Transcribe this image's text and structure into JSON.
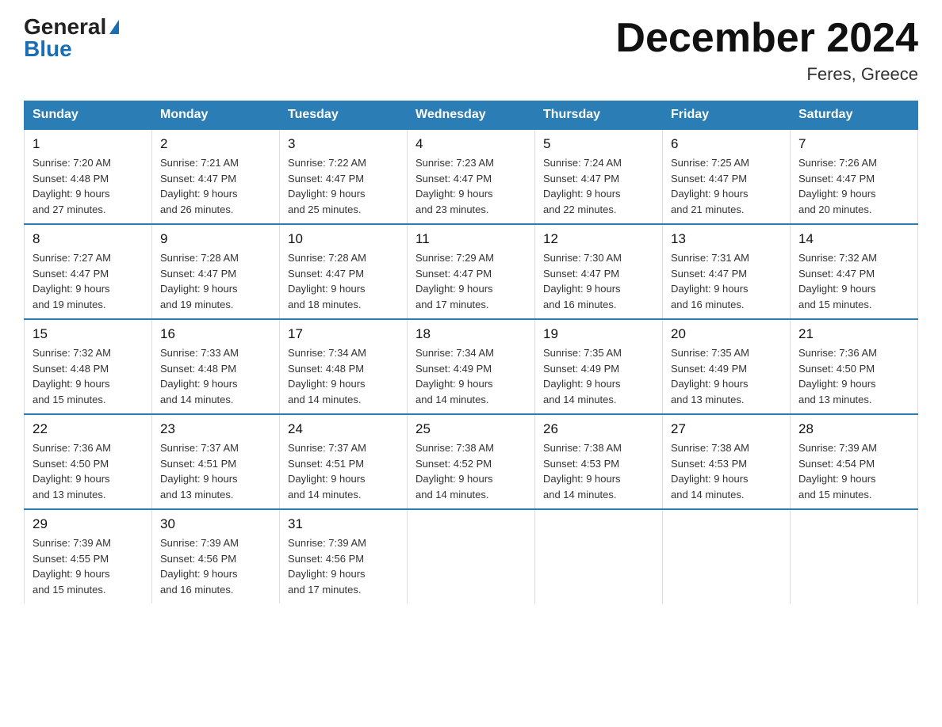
{
  "logo": {
    "general": "General",
    "blue": "Blue"
  },
  "title": "December 2024",
  "location": "Feres, Greece",
  "days_of_week": [
    "Sunday",
    "Monday",
    "Tuesday",
    "Wednesday",
    "Thursday",
    "Friday",
    "Saturday"
  ],
  "weeks": [
    [
      {
        "day": "1",
        "sunrise": "7:20 AM",
        "sunset": "4:48 PM",
        "daylight": "9 hours and 27 minutes."
      },
      {
        "day": "2",
        "sunrise": "7:21 AM",
        "sunset": "4:47 PM",
        "daylight": "9 hours and 26 minutes."
      },
      {
        "day": "3",
        "sunrise": "7:22 AM",
        "sunset": "4:47 PM",
        "daylight": "9 hours and 25 minutes."
      },
      {
        "day": "4",
        "sunrise": "7:23 AM",
        "sunset": "4:47 PM",
        "daylight": "9 hours and 23 minutes."
      },
      {
        "day": "5",
        "sunrise": "7:24 AM",
        "sunset": "4:47 PM",
        "daylight": "9 hours and 22 minutes."
      },
      {
        "day": "6",
        "sunrise": "7:25 AM",
        "sunset": "4:47 PM",
        "daylight": "9 hours and 21 minutes."
      },
      {
        "day": "7",
        "sunrise": "7:26 AM",
        "sunset": "4:47 PM",
        "daylight": "9 hours and 20 minutes."
      }
    ],
    [
      {
        "day": "8",
        "sunrise": "7:27 AM",
        "sunset": "4:47 PM",
        "daylight": "9 hours and 19 minutes."
      },
      {
        "day": "9",
        "sunrise": "7:28 AM",
        "sunset": "4:47 PM",
        "daylight": "9 hours and 19 minutes."
      },
      {
        "day": "10",
        "sunrise": "7:28 AM",
        "sunset": "4:47 PM",
        "daylight": "9 hours and 18 minutes."
      },
      {
        "day": "11",
        "sunrise": "7:29 AM",
        "sunset": "4:47 PM",
        "daylight": "9 hours and 17 minutes."
      },
      {
        "day": "12",
        "sunrise": "7:30 AM",
        "sunset": "4:47 PM",
        "daylight": "9 hours and 16 minutes."
      },
      {
        "day": "13",
        "sunrise": "7:31 AM",
        "sunset": "4:47 PM",
        "daylight": "9 hours and 16 minutes."
      },
      {
        "day": "14",
        "sunrise": "7:32 AM",
        "sunset": "4:47 PM",
        "daylight": "9 hours and 15 minutes."
      }
    ],
    [
      {
        "day": "15",
        "sunrise": "7:32 AM",
        "sunset": "4:48 PM",
        "daylight": "9 hours and 15 minutes."
      },
      {
        "day": "16",
        "sunrise": "7:33 AM",
        "sunset": "4:48 PM",
        "daylight": "9 hours and 14 minutes."
      },
      {
        "day": "17",
        "sunrise": "7:34 AM",
        "sunset": "4:48 PM",
        "daylight": "9 hours and 14 minutes."
      },
      {
        "day": "18",
        "sunrise": "7:34 AM",
        "sunset": "4:49 PM",
        "daylight": "9 hours and 14 minutes."
      },
      {
        "day": "19",
        "sunrise": "7:35 AM",
        "sunset": "4:49 PM",
        "daylight": "9 hours and 14 minutes."
      },
      {
        "day": "20",
        "sunrise": "7:35 AM",
        "sunset": "4:49 PM",
        "daylight": "9 hours and 13 minutes."
      },
      {
        "day": "21",
        "sunrise": "7:36 AM",
        "sunset": "4:50 PM",
        "daylight": "9 hours and 13 minutes."
      }
    ],
    [
      {
        "day": "22",
        "sunrise": "7:36 AM",
        "sunset": "4:50 PM",
        "daylight": "9 hours and 13 minutes."
      },
      {
        "day": "23",
        "sunrise": "7:37 AM",
        "sunset": "4:51 PM",
        "daylight": "9 hours and 13 minutes."
      },
      {
        "day": "24",
        "sunrise": "7:37 AM",
        "sunset": "4:51 PM",
        "daylight": "9 hours and 14 minutes."
      },
      {
        "day": "25",
        "sunrise": "7:38 AM",
        "sunset": "4:52 PM",
        "daylight": "9 hours and 14 minutes."
      },
      {
        "day": "26",
        "sunrise": "7:38 AM",
        "sunset": "4:53 PM",
        "daylight": "9 hours and 14 minutes."
      },
      {
        "day": "27",
        "sunrise": "7:38 AM",
        "sunset": "4:53 PM",
        "daylight": "9 hours and 14 minutes."
      },
      {
        "day": "28",
        "sunrise": "7:39 AM",
        "sunset": "4:54 PM",
        "daylight": "9 hours and 15 minutes."
      }
    ],
    [
      {
        "day": "29",
        "sunrise": "7:39 AM",
        "sunset": "4:55 PM",
        "daylight": "9 hours and 15 minutes."
      },
      {
        "day": "30",
        "sunrise": "7:39 AM",
        "sunset": "4:56 PM",
        "daylight": "9 hours and 16 minutes."
      },
      {
        "day": "31",
        "sunrise": "7:39 AM",
        "sunset": "4:56 PM",
        "daylight": "9 hours and 17 minutes."
      },
      null,
      null,
      null,
      null
    ]
  ],
  "labels": {
    "sunrise": "Sunrise:",
    "sunset": "Sunset:",
    "daylight": "Daylight:"
  }
}
